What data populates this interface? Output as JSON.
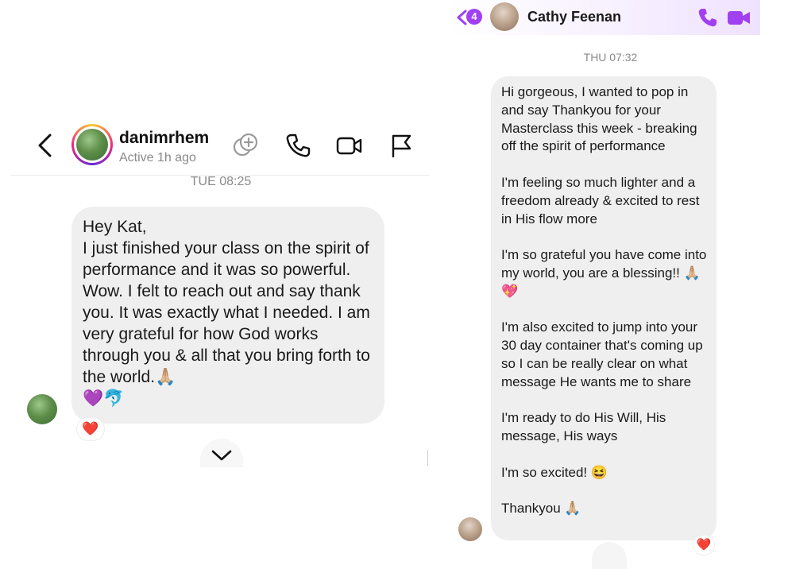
{
  "left": {
    "username": "danimrhem",
    "activity": "Active 1h ago",
    "timestamp": "TUE 08:25",
    "message": "Hey Kat,\nI just finished your class on the spirit of performance and it was so powerful. Wow. I felt to reach out and say thank you. It was exactly what I needed. I am very grateful for how God works through you & all that you bring forth to the world.🙏🏼\n💜🐬",
    "reaction": "❤️",
    "icons": [
      "back-icon",
      "add-people-icon",
      "phone-icon",
      "video-icon",
      "flag-icon",
      "chevron-down-icon"
    ]
  },
  "right": {
    "unread_count": "4",
    "contact_name": "Cathy Feenan",
    "timestamp": "THU 07:32",
    "paragraphs": [
      "Hi gorgeous, I wanted to pop in and say Thankyou for your Masterclass this week - breaking off the spirit of performance",
      "I'm feeling so much lighter and a freedom already & excited to rest in His flow more",
      "I'm so grateful you have come into my world, you are a blessing!! 🙏🏼💖",
      "I'm also excited to jump into your 30 day container that's coming up so I can be really clear on what message He wants me to share",
      "I'm ready to do His Will, His message, His ways",
      "I'm so excited! 😆",
      "Thankyou 🙏🏼"
    ],
    "reaction": "❤️",
    "accent_color": "#a040f0"
  }
}
